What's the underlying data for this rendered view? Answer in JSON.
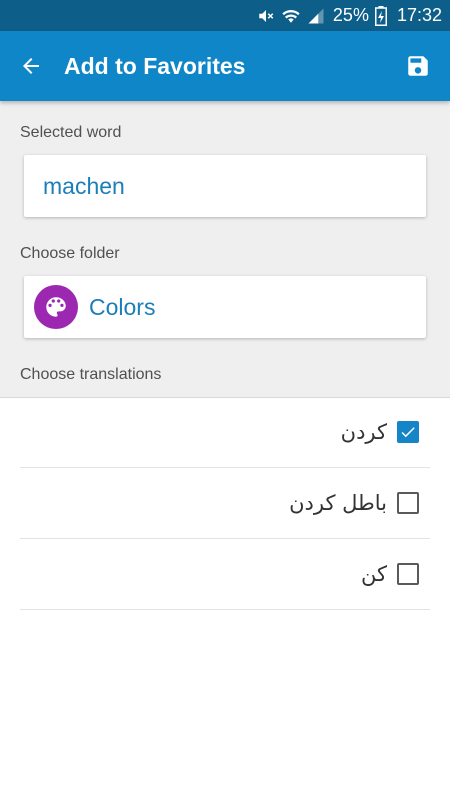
{
  "status_bar": {
    "battery_percent": "25%",
    "time": "17:32",
    "icons": [
      "muted-icon",
      "wifi-icon",
      "signal-icon",
      "battery-charging-icon"
    ]
  },
  "app_bar": {
    "title": "Add to Favorites",
    "back_icon": "arrow-back-icon",
    "save_icon": "save-icon"
  },
  "form": {
    "selected_word_label": "Selected word",
    "selected_word_value": "machen",
    "choose_folder_label": "Choose folder",
    "folder": {
      "name": "Colors",
      "icon": "palette-icon",
      "icon_color": "#9c27b0"
    },
    "choose_translations_label": "Choose translations"
  },
  "translations": [
    {
      "text": "کردن",
      "checked": true
    },
    {
      "text": "باطل کردن",
      "checked": false
    },
    {
      "text": "کن",
      "checked": false
    }
  ],
  "colors": {
    "status_bar": "#0d5f8a",
    "app_bar": "#0f86c8",
    "accent_text": "#1a7fb8",
    "checkbox_checked": "#1585c8"
  }
}
